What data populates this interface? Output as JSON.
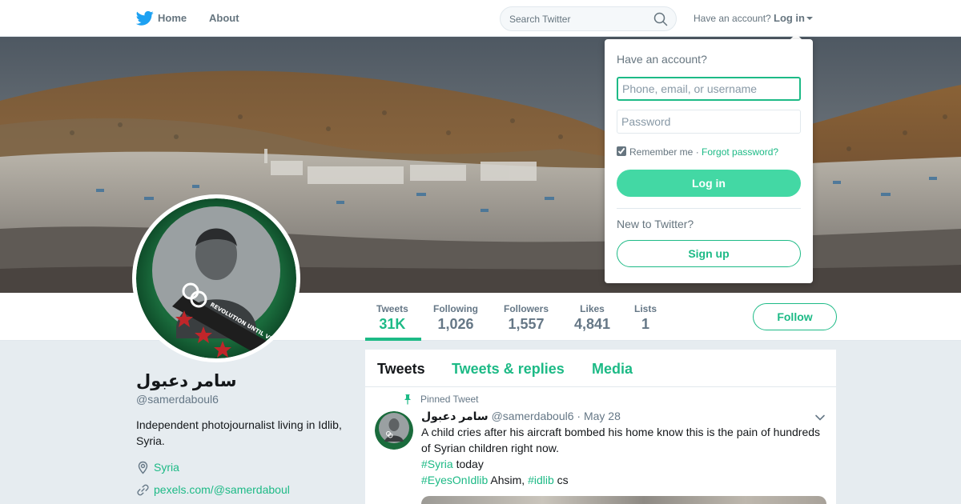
{
  "nav": {
    "home_label": "Home",
    "about_label": "About",
    "search_placeholder": "Search Twitter",
    "have_account_text": "Have an account?",
    "login_label": "Log in"
  },
  "profile": {
    "display_name": "سامر دعبول",
    "screen_name": "@samerdaboul6",
    "bio": "Independent photojournalist living in Idlib, Syria.",
    "location": "Syria",
    "website": "pexels.com/@samerdaboul",
    "avatar_text": "REVOLUTION UNTIL VICTORY"
  },
  "stats": [
    {
      "label": "Tweets",
      "value": "31K",
      "active": true
    },
    {
      "label": "Following",
      "value": "1,026",
      "active": false
    },
    {
      "label": "Followers",
      "value": "1,557",
      "active": false
    },
    {
      "label": "Likes",
      "value": "4,841",
      "active": false
    },
    {
      "label": "Lists",
      "value": "1",
      "active": false
    }
  ],
  "follow_label": "Follow",
  "tabs": {
    "tweets": "Tweets",
    "replies": "Tweets & replies",
    "media": "Media"
  },
  "pinned_tweet": {
    "pinned_label": "Pinned Tweet",
    "name": "سامر دعبول",
    "handle": "@samerdaboul6",
    "separator": " · ",
    "date": "May 28",
    "line1": "A child cries after his aircraft bombed his home know this is the pain of hundreds of Syrian children right now.",
    "hashtag_syria": "#Syria",
    "text_today": " today",
    "hashtag_eyes": "#EyesOnIdlib",
    "text_ahsim": " Ahsim, ",
    "hashtag_idlib": "#idlib",
    "text_cs": " cs"
  },
  "login_dropdown": {
    "heading": "Have an account?",
    "username_placeholder": "Phone, email, or username",
    "password_placeholder": "Password",
    "remember_label": "Remember me",
    "remember_separator": " · ",
    "forgot_label": "Forgot password?",
    "login_button": "Log in",
    "new_to_twitter": "New to Twitter?",
    "signup_button": "Sign up"
  },
  "colors": {
    "accent": "#1dba86",
    "login_button_bg": "#43d8a4",
    "twitter_blue": "#1da1f2",
    "muted_text": "#657786",
    "page_bg": "#e6ecf0"
  },
  "icons": {
    "logo": "twitter-bird-icon",
    "search": "search-icon",
    "location": "location-pin-icon",
    "link": "link-icon",
    "pinned": "pushpin-icon",
    "caret": "chevron-down-icon"
  }
}
